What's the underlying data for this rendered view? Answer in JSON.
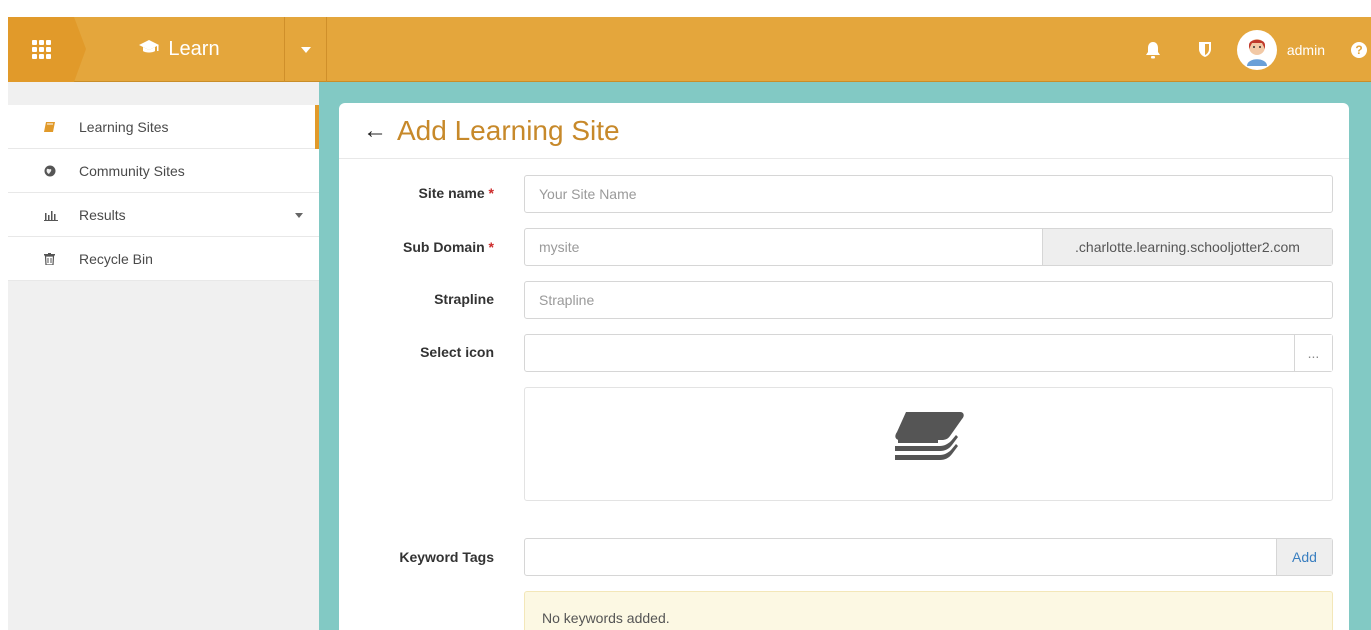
{
  "topbar": {
    "app_label": "Learn",
    "user_name": "admin",
    "help_glyph": "?",
    "accent_color": "#e4a63c"
  },
  "sidebar": {
    "items": [
      {
        "label": "Learning Sites",
        "icon": "book-icon",
        "active": true
      },
      {
        "label": "Community Sites",
        "icon": "globe-icon",
        "active": false
      },
      {
        "label": "Results",
        "icon": "bar-chart-icon",
        "active": false,
        "has_dropdown": true
      },
      {
        "label": "Recycle Bin",
        "icon": "trash-icon",
        "active": false
      }
    ]
  },
  "main": {
    "back_glyph": "←",
    "title": "Add Learning Site",
    "fields": {
      "site_name": {
        "label": "Site name",
        "required_mark": "*",
        "placeholder": "Your Site Name",
        "value": ""
      },
      "sub_domain": {
        "label": "Sub Domain",
        "required_mark": "*",
        "placeholder": "mysite",
        "value": "",
        "suffix": ".charlotte.learning.schooljotter2.com"
      },
      "strapline": {
        "label": "Strapline",
        "placeholder": "Strapline",
        "value": ""
      },
      "select_icon": {
        "label": "Select icon",
        "value": "",
        "browse_label": "..."
      },
      "keyword_tags": {
        "label": "Keyword Tags",
        "value": "",
        "add_label": "Add",
        "empty_message": "No keywords added."
      }
    }
  }
}
